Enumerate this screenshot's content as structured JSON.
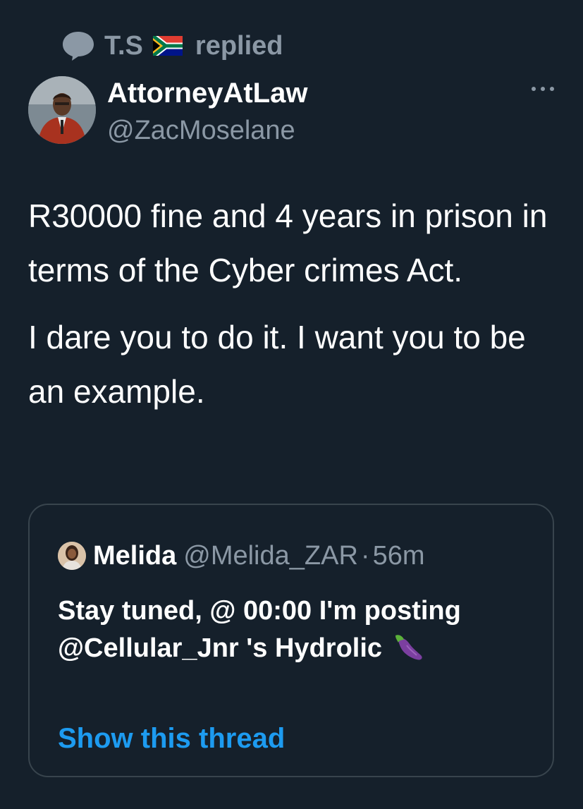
{
  "context": {
    "user": "T.S",
    "action": "replied"
  },
  "tweet": {
    "author_name": "AttorneyAtLaw",
    "author_handle": "@ZacMoselane",
    "paragraphs": [
      "R30000 fine and 4 years in prison in terms of the Cyber crimes Act.",
      "I dare you to do it. I want you to be an example."
    ]
  },
  "quote": {
    "name": "Melida",
    "handle": "@Melida_ZAR",
    "separator": "·",
    "time": "56m",
    "text": "Stay tuned, @ 00:00 I'm posting @Cellular_Jnr 's Hydrolic",
    "show_thread": "Show this thread"
  },
  "icons": {
    "context": "speech-bubble-icon",
    "flag": "south-africa-flag-icon",
    "more": "more-options-icon",
    "emoji": "eggplant-icon"
  },
  "colors": {
    "background": "#15202b",
    "secondary_text": "#8b98a5",
    "link": "#1d9bf0",
    "border": "#38444d"
  }
}
